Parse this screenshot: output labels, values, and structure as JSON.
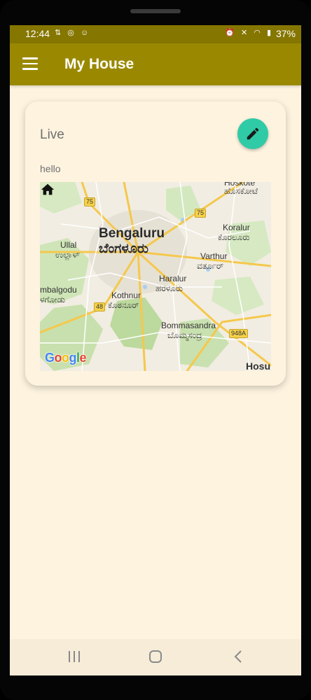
{
  "status_bar": {
    "time": "12:44",
    "battery": "37%",
    "left_icons": [
      "data-speed-icon",
      "instagram-icon",
      "snapchat-icon"
    ],
    "right_icons": [
      "alarm-icon",
      "mute-icon",
      "wifi-icon",
      "volte-icon",
      "signal-icon"
    ]
  },
  "app_bar": {
    "menu_icon": "hamburger-menu-icon",
    "title": "My House"
  },
  "card": {
    "status": "Live",
    "note": "hello",
    "edit_icon": "pencil-icon",
    "edit_button_color": "#2ecba6"
  },
  "map": {
    "labels": {
      "bengaluru_en": "Bengaluru",
      "bengaluru_kn": "ಬೆಂಗಳೂರು",
      "hoskote_en": "Hoskote",
      "hoskote_kn": "ಹೊಸಕೋಟೆ",
      "koralur_en": "Koralur",
      "koralur_kn": "ಕೊರಲೂರು",
      "ullal_en": "Ullal",
      "ullal_kn": "ಉಲ್ಲಾಳ್",
      "varthur_en": "Varthur",
      "varthur_kn": "ವರ್ತೂರ್",
      "haralur_en": "Haralur",
      "haralur_kn": "ಹರಳೂರು",
      "kumbalgodu_en": "mbalgodu",
      "kumbalgodu_kn": "ಳಗೋಡು",
      "kothnur_en": "Kothnur",
      "kothnur_kn": "ಕೊಠನೂರ್",
      "bommasandra_en": "Bommasandra",
      "bommasandra_kn": "ಬೊಮ್ಮಸಂದ್ರ",
      "hosur_en": "Hosu"
    },
    "shields": [
      "75",
      "75",
      "48",
      "948A"
    ],
    "attribution": "Google",
    "marker_icon": "home-icon"
  },
  "nav_bar": {
    "recents_icon": "recents-icon",
    "home_icon": "home-nav-icon",
    "back_icon": "back-icon"
  }
}
